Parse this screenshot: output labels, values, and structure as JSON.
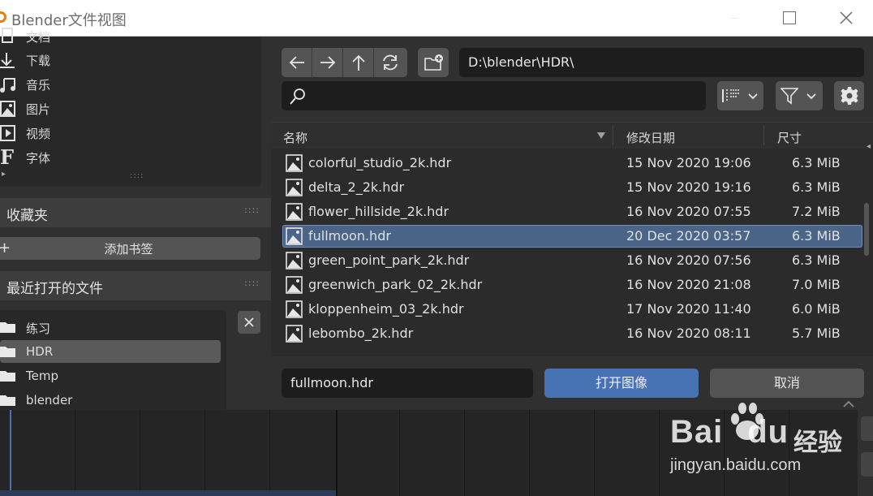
{
  "window": {
    "title": "Blender文件视图",
    "accent": "#e87d0d"
  },
  "places": {
    "items": [
      {
        "label": "文档",
        "icon": "document-icon"
      },
      {
        "label": "下载",
        "icon": "download-icon"
      },
      {
        "label": "音乐",
        "icon": "music-icon"
      },
      {
        "label": "图片",
        "icon": "image-icon"
      },
      {
        "label": "视频",
        "icon": "video-icon"
      },
      {
        "label": "字体",
        "icon": "font-icon"
      }
    ]
  },
  "bookmarks": {
    "header": "收藏夹",
    "add_label": "添加书签"
  },
  "recent": {
    "header": "最近打开的文件",
    "items": [
      {
        "label": "练习"
      },
      {
        "label": "HDR"
      },
      {
        "label": "Temp"
      },
      {
        "label": "blender"
      }
    ],
    "selected": "HDR"
  },
  "path": {
    "value": "D:\\blender\\HDR\\"
  },
  "search": {
    "placeholder": ""
  },
  "columns": {
    "name": "名称",
    "date": "修改日期",
    "size": "尺寸"
  },
  "files": [
    {
      "name": "colorful_studio_2k.hdr",
      "date": "15 Nov 2020 19:06",
      "size": "6.3 MiB"
    },
    {
      "name": "delta_2_2k.hdr",
      "date": "15 Nov 2020 19:16",
      "size": "6.3 MiB"
    },
    {
      "name": "flower_hillside_2k.hdr",
      "date": "16 Nov 2020 07:55",
      "size": "7.2 MiB"
    },
    {
      "name": "fullmoon.hdr",
      "date": "20 Dec 2020 03:57",
      "size": "6.3 MiB"
    },
    {
      "name": "green_point_park_2k.hdr",
      "date": "16 Nov 2020 07:56",
      "size": "6.3 MiB"
    },
    {
      "name": "greenwich_park_02_2k.hdr",
      "date": "16 Nov 2020 21:08",
      "size": "7.0 MiB"
    },
    {
      "name": "kloppenheim_03_2k.hdr",
      "date": "17 Nov 2020 11:40",
      "size": "6.0 MiB"
    },
    {
      "name": "lebombo_2k.hdr",
      "date": "16 Nov 2020 08:11",
      "size": "5.7 MiB"
    }
  ],
  "selected_file": "fullmoon.hdr",
  "bottom": {
    "filename": "fullmoon.hdr",
    "open_label": "打开图像",
    "cancel_label": "取消",
    "open_color": "#4772b3",
    "selection_color": "#4a6587"
  },
  "watermark": {
    "logo": "Bai",
    "logo2": "du",
    "cn": "经验",
    "url": "jingyan.baidu.com"
  }
}
